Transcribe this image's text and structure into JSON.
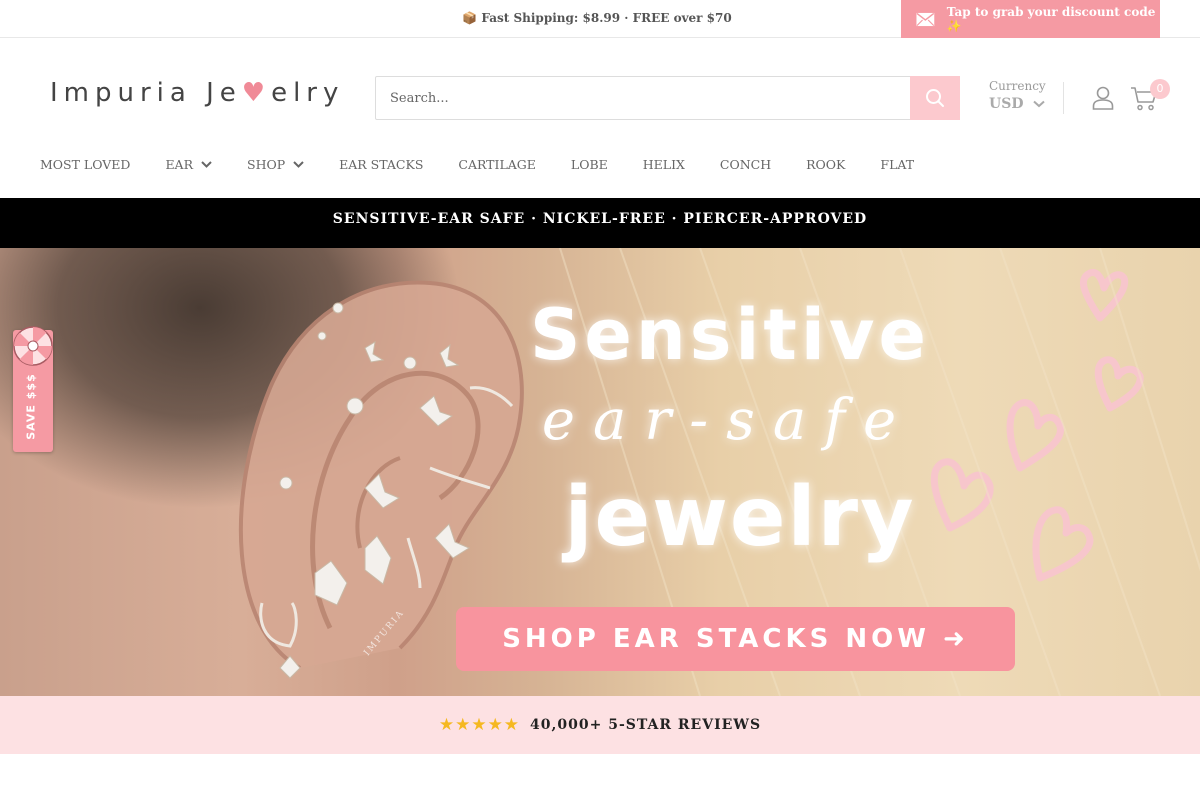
{
  "announcement": {
    "shipping": "📦 Fast Shipping: $8.99 · FREE over $70",
    "discount": "Tap to grab your discount code ✨"
  },
  "header": {
    "logo_part1": "Impuria Je",
    "logo_heart": "♥",
    "logo_part2": "elry",
    "search_placeholder": "Search...",
    "currency_label": "Currency",
    "currency_value": "USD",
    "cart_count": "0"
  },
  "nav": {
    "items": [
      "MOST LOVED",
      "EAR",
      "SHOP",
      "EAR STACKS",
      "CARTILAGE",
      "LOBE",
      "HELIX",
      "CONCH",
      "ROOK",
      "FLAT"
    ]
  },
  "trust_strip": "SENSITIVE-EAR SAFE · NICKEL-FREE · PIERCER-APPROVED",
  "hero": {
    "line1": "Sensitive",
    "line2": "ear-safe",
    "line3": "jewelry",
    "cta": "SHOP EAR STACKS NOW ➜",
    "stamp": "IMPURIA"
  },
  "save_tab": "SAVE $$$",
  "reviews": {
    "stars": "★★★★★",
    "text": "40,000+ 5-STAR REVIEWS"
  },
  "colors": {
    "accent_pink": "#f59aa3",
    "light_pink": "#fde1e3",
    "star_gold": "#f5b820"
  }
}
